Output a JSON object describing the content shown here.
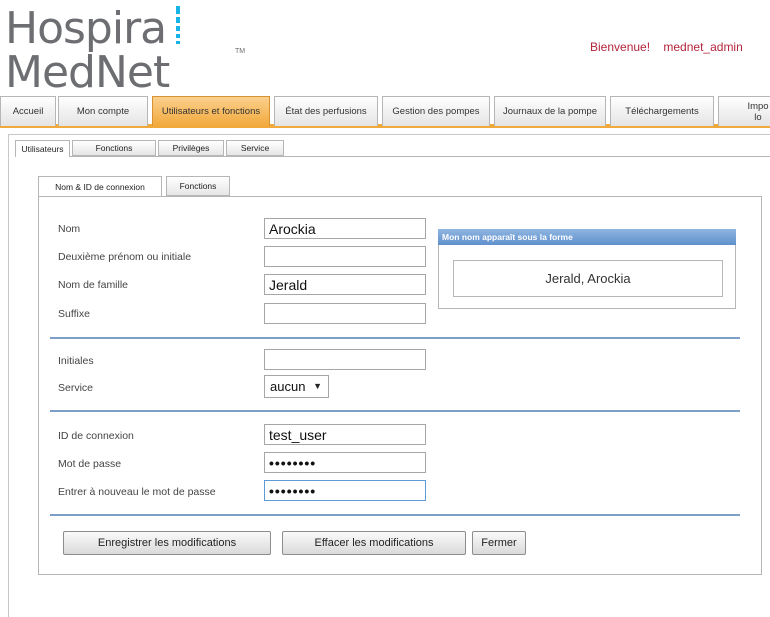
{
  "header": {
    "logo_line1": "Hospira",
    "logo_line2": "MedNet",
    "logo_tm": "TM",
    "welcome_label": "Bienvenue!",
    "username": "mednet_admin"
  },
  "main_nav": [
    {
      "label": "Accueil",
      "active": false
    },
    {
      "label": "Mon compte",
      "active": false
    },
    {
      "label": "Utilisateurs et fonctions",
      "active": true
    },
    {
      "label": "État des perfusions",
      "active": false
    },
    {
      "label": "Gestion des pompes",
      "active": false
    },
    {
      "label": "Journaux de la pompe",
      "active": false
    },
    {
      "label": "Téléchargements",
      "active": false
    },
    {
      "label": "Impo lo",
      "active": false
    }
  ],
  "sub_tabs": [
    {
      "label": "Utilisateurs",
      "active": true
    },
    {
      "label": "Fonctions",
      "active": false
    },
    {
      "label": "Privilèges",
      "active": false
    },
    {
      "label": "Service",
      "active": false
    }
  ],
  "inner_tabs": [
    {
      "label": "Nom & ID de connexion",
      "active": true
    },
    {
      "label": "Fonctions",
      "active": false
    }
  ],
  "form": {
    "nom_label": "Nom",
    "nom_value": "Arockia",
    "deuxieme_label": "Deuxième prénom ou initiale",
    "deuxieme_value": "",
    "famille_label": "Nom de famille",
    "famille_value": "Jerald",
    "suffixe_label": "Suffixe",
    "suffixe_value": "",
    "initiales_label": "Initiales",
    "initiales_value": "",
    "service_label": "Service",
    "service_value": "aucun",
    "login_label": "ID de connexion",
    "login_value": "test_user",
    "password_label": "Mot de passe",
    "password_value": "••••••••",
    "password2_label": "Entrer à nouveau le mot de passe",
    "password2_value": "••••••••"
  },
  "display_name": {
    "header": "Mon nom apparaît sous la forme",
    "value": "Jerald, Arockia"
  },
  "buttons": {
    "save": "Enregistrer les modifications",
    "clear": "Effacer les modifications",
    "close": "Fermer"
  },
  "colors": {
    "accent_orange": "#f2a93b",
    "logo_blue": "#18b4e8",
    "welcome_red": "#b3243a",
    "divider_blue": "#7d9ec6"
  }
}
